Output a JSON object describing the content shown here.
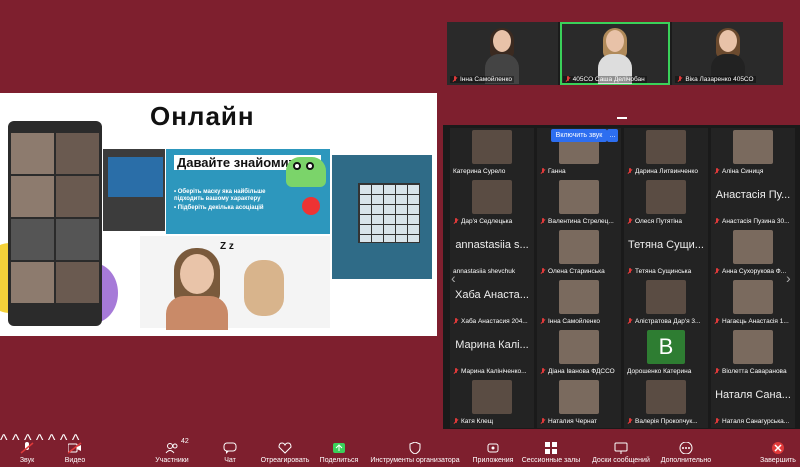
{
  "speakers": [
    {
      "name": "Інна Самойленко",
      "muted": true,
      "active": false
    },
    {
      "name": "405СО Саша Делічобан",
      "muted": true,
      "active": true
    },
    {
      "name": "Віка Лазаренко 405СО",
      "muted": true,
      "active": false
    }
  ],
  "slide": {
    "title": "Онлайн",
    "card_title": "Давайте знайомитись",
    "card_bullets": [
      "• Оберіть маску яка найбільше підходить вашому характеру",
      "• Підберіть декілька асоціацій"
    ]
  },
  "gallery": {
    "unmute_label": "Включить звук",
    "more_label": "...",
    "tiles": [
      {
        "type": "video",
        "name": "Катерина Сурело",
        "muted": false
      },
      {
        "type": "video",
        "name": "Ганна",
        "muted": true
      },
      {
        "type": "video",
        "name": "Дарина Литвинченко",
        "muted": true
      },
      {
        "type": "video",
        "name": "Аліна Синиця",
        "muted": true
      },
      {
        "type": "video",
        "name": "Дар'я Седлецька",
        "muted": true
      },
      {
        "type": "video",
        "name": "Валентина Стрелец...",
        "muted": true
      },
      {
        "type": "video",
        "name": "Олеся Путятіна",
        "muted": true
      },
      {
        "type": "text",
        "big": "Анастасія Пу...",
        "name": "Анастасія Пузина 30...",
        "muted": true
      },
      {
        "type": "text",
        "big": "annastasiia s...",
        "name": "annastasiia shevchuk",
        "muted": false
      },
      {
        "type": "video",
        "name": "Олена Старинська",
        "muted": true
      },
      {
        "type": "text",
        "big": "Тетяна Сущи...",
        "name": "Тетяна Сущинська",
        "muted": true
      },
      {
        "type": "video",
        "name": "Анна Сухорукова Ф...",
        "muted": true
      },
      {
        "type": "text",
        "big": "Хаба Анаста...",
        "name": "Хаба Анастасия 204...",
        "muted": true
      },
      {
        "type": "video",
        "name": "Інна Самойленко",
        "muted": true
      },
      {
        "type": "video",
        "name": "Алістратова Дар'я 3...",
        "muted": true
      },
      {
        "type": "video",
        "name": "Нагаєць Анастасія 1...",
        "muted": true
      },
      {
        "type": "text",
        "big": "Марина Калі...",
        "name": "Марина Калініченко...",
        "muted": true
      },
      {
        "type": "video",
        "name": "Діана Іванова ФДССО",
        "muted": true
      },
      {
        "type": "letter",
        "big": "B",
        "name": "Дорошенко Катерина",
        "muted": false
      },
      {
        "type": "video",
        "name": "Віолетта Саваранова",
        "muted": true
      },
      {
        "type": "video",
        "name": "Катя Клещ",
        "muted": true
      },
      {
        "type": "video",
        "name": "Наталия Чернат",
        "muted": true
      },
      {
        "type": "video",
        "name": "Валерія Прокопчук...",
        "muted": true
      },
      {
        "type": "text",
        "big": "Наталя Сана...",
        "name": "Наталя Санагурська...",
        "muted": true
      }
    ]
  },
  "toolbar": {
    "participants_count": "42",
    "items": [
      {
        "key": "mute",
        "label": "Звук"
      },
      {
        "key": "video",
        "label": "Видео"
      },
      {
        "key": "participants",
        "label": "Участники"
      },
      {
        "key": "chat",
        "label": "Чат"
      },
      {
        "key": "react",
        "label": "Отреагировать"
      },
      {
        "key": "share",
        "label": "Поделиться"
      },
      {
        "key": "host",
        "label": "Инструменты организатора"
      },
      {
        "key": "apps",
        "label": "Приложения"
      },
      {
        "key": "rooms",
        "label": "Сессионные залы"
      },
      {
        "key": "whiteboard",
        "label": "Доски сообщений"
      },
      {
        "key": "more",
        "label": "Дополнительно"
      },
      {
        "key": "end",
        "label": "Завершить"
      }
    ]
  },
  "colors": {
    "background": "#7e1f2e",
    "accent": "#2d6ef0",
    "active_border": "#3ad15a",
    "muted": "#e03a3a"
  }
}
